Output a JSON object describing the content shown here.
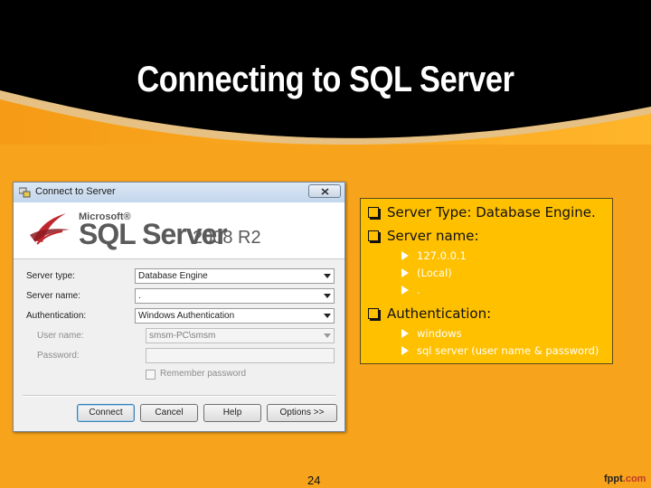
{
  "slide": {
    "title": "Connecting to SQL Server",
    "page_number": "24",
    "brand_prefix": "fppt",
    "brand_suffix": ".com"
  },
  "dialog": {
    "title": "Connect to Server",
    "banner": {
      "microsoft": "Microsoft®",
      "product": "SQL Server",
      "version": "2008 R2"
    },
    "server_type_label": "Server type:",
    "server_type_value": "Database Engine",
    "server_name_label": "Server name:",
    "server_name_value": ".",
    "authentication_label": "Authentication:",
    "authentication_value": "Windows Authentication",
    "user_name_label": "User name:",
    "user_name_value": "smsm-PC\\smsm",
    "password_label": "Password:",
    "remember_password_label": "Remember password",
    "buttons": {
      "connect": "Connect",
      "cancel": "Cancel",
      "help": "Help",
      "options": "Options >>"
    }
  },
  "info": {
    "server_type_line": "Server Type: Database Engine.",
    "server_name_line": "Server name:",
    "server_names": [
      "127.0.0.1",
      "(Local)",
      "."
    ],
    "authentication_line": "Authentication:",
    "auth_options": [
      "windows",
      "sql server (user name & password)"
    ]
  },
  "colors": {
    "slide_background": "#f7a41c",
    "header_background": "#000000",
    "info_box": "#ffc000"
  }
}
